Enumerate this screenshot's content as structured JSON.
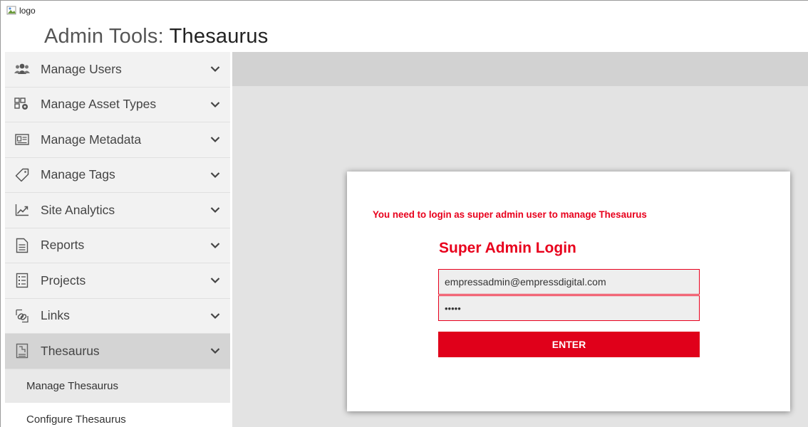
{
  "header": {
    "logo_alt": "logo",
    "title_prefix": "Admin Tools: ",
    "title_section": "Thesaurus"
  },
  "sidebar": {
    "items": [
      {
        "label": "Manage Users",
        "icon": "users-icon"
      },
      {
        "label": "Manage Asset Types",
        "icon": "asset-types-icon"
      },
      {
        "label": "Manage Metadata",
        "icon": "metadata-icon"
      },
      {
        "label": "Manage Tags",
        "icon": "tag-icon"
      },
      {
        "label": "Site Analytics",
        "icon": "analytics-chart-icon"
      },
      {
        "label": "Reports",
        "icon": "report-document-icon"
      },
      {
        "label": "Projects",
        "icon": "projects-list-icon"
      },
      {
        "label": "Links",
        "icon": "link-icon"
      },
      {
        "label": "Thesaurus",
        "icon": "thesaurus-icon",
        "active": true
      }
    ],
    "subitems": [
      {
        "label": "Manage Thesaurus",
        "active": true
      },
      {
        "label": "Configure Thesaurus"
      }
    ]
  },
  "login": {
    "warning": "You need to login as super admin user to manage Thesaurus",
    "heading": "Super Admin Login",
    "email_value": "empressadmin@empressdigital.com",
    "password_value": "•••••",
    "enter_label": "ENTER"
  },
  "colors": {
    "accent": "#e8001c",
    "sidebar_bg": "#f2f2f2",
    "sidebar_active": "#d4d4d4",
    "main_bg": "#e3e3e3"
  }
}
